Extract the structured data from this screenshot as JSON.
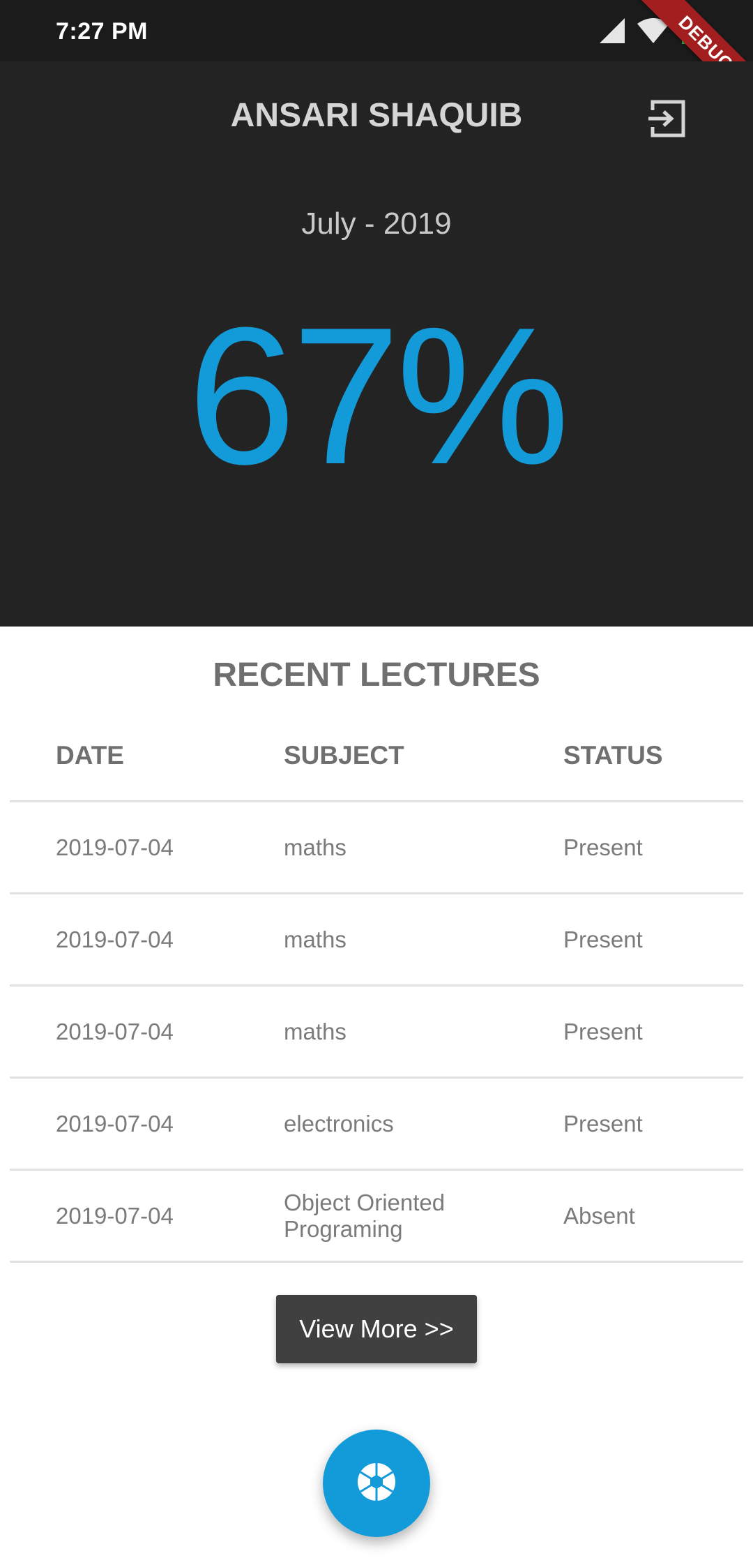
{
  "status_bar": {
    "time": "7:27 PM",
    "icons": [
      "signal-icon",
      "wifi-icon",
      "battery-icon"
    ]
  },
  "debug_banner": "DEBUG",
  "header": {
    "title": "ANSARI SHAQUIB",
    "month": "July - 2019",
    "percentage": "67%",
    "logout_icon": "logout-icon"
  },
  "lectures": {
    "title": "RECENT LECTURES",
    "columns": [
      "DATE",
      "SUBJECT",
      "STATUS"
    ],
    "rows": [
      {
        "date": "2019-07-04",
        "subject": "maths",
        "status": "Present"
      },
      {
        "date": "2019-07-04",
        "subject": "maths",
        "status": "Present"
      },
      {
        "date": "2019-07-04",
        "subject": "maths",
        "status": "Present"
      },
      {
        "date": "2019-07-04",
        "subject": "electronics",
        "status": "Present"
      },
      {
        "date": "2019-07-04",
        "subject": "Object Oriented Programing",
        "status": "Absent"
      }
    ]
  },
  "view_more_label": "View More >>",
  "fab_icon": "camera-shutter-icon",
  "colors": {
    "accent": "#129bd8",
    "header_bg": "#232323",
    "status_bar_bg": "#1b1b1b",
    "button_bg": "#404040",
    "debug_banner": "#a31f1f",
    "battery_level": "#2ecc40"
  }
}
